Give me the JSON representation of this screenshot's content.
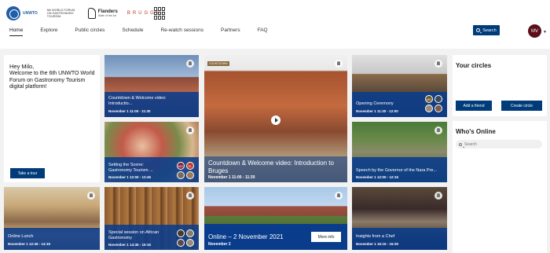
{
  "header": {
    "unwto_logo": "UNWTO",
    "forum_logo": "6th WORLD FORUM ON GASTRONOMY TOURISM",
    "flanders_logo": "Flanders",
    "flanders_sub": "State of the Art",
    "brugge_logo": "BRUGGE"
  },
  "nav": [
    "Home",
    "Explore",
    "Public circles",
    "Schedule",
    "Re-watch sessions",
    "Partners",
    "FAQ"
  ],
  "search_label": "Search",
  "user_initials": "MV",
  "welcome": {
    "greeting": "Hey Milo,",
    "message": "Welcome to the 6th UNWTO World Forum on Gastronomy Tourism digital platform!",
    "tour_button": "Take a tour"
  },
  "sessions": [
    {
      "title": "Countdown & Welcome video: Introductio...",
      "time": "November 1 11:00 - 11:30"
    },
    {
      "title": "Setting the Scene: Gastronomy Tourism ...",
      "time": "November 1 12:00 - 12:45",
      "speakers": [
        "MG",
        "EL"
      ]
    },
    {
      "title": "Countdown & Welcome video: Introduction to Bruges",
      "time": "November 1 11:00 - 11:30",
      "tag": "COUNTDOWN"
    },
    {
      "title": "Opening Ceremony",
      "time": "November 1 11:30 - 12:00",
      "speakers": [
        "MD"
      ]
    },
    {
      "title": "Speech by the Governor of the Nara Pre...",
      "time": "November 1 12:00 - 12:15"
    },
    {
      "title": "Online Lunch",
      "time": "November 1 12:45 - 14:15"
    },
    {
      "title": "Special session on African Gastronomy",
      "time": "November 1 14:45 - 15:15"
    },
    {
      "title": "Online – 2 November 2021",
      "time": "November 2",
      "button": "More info"
    },
    {
      "title": "Insights from a Chef",
      "time": "November 1 15:15 - 15:30"
    }
  ],
  "circles": {
    "title": "Your circles",
    "add_friend": "Add a friend",
    "create_circle": "Create circle"
  },
  "who_online": {
    "title": "Who's Online",
    "placeholder": "Search"
  },
  "colors": {
    "brand_blue": "#003c7a",
    "band_blue": "#0a3c8c",
    "avatar": "#5a0f1a"
  }
}
